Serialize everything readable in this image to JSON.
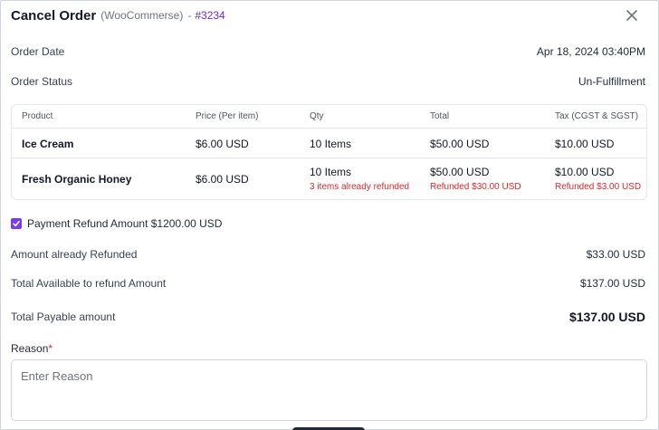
{
  "header": {
    "title": "Cancel Order",
    "source": "(WooCommerse)",
    "separator": "-",
    "order_ref": "#3234",
    "close_icon": "close-icon"
  },
  "order_date": {
    "label": "Order Date",
    "value": "Apr 18, 2024 03:40PM"
  },
  "order_status": {
    "label": "Order Status",
    "value": "Un-Fulfillment",
    "color": "#dc2626"
  },
  "table": {
    "columns": [
      "Product",
      "Price (Per item)",
      "Qty",
      "Total",
      "Tax (CGST & SGST)"
    ],
    "rows": [
      {
        "product": "Ice Cream",
        "price": "$6.00 USD",
        "qty": "10 Items",
        "qty_note": "",
        "total": "$50.00 USD",
        "total_note": "",
        "tax": "$10.00 USD",
        "tax_note": ""
      },
      {
        "product": "Fresh Organic Honey",
        "price": "$6.00 USD",
        "qty": "10 Items",
        "qty_note": "3 items already refunded",
        "total": "$50.00 USD",
        "total_note": "Refunded $30.00 USD",
        "tax": "$10.00 USD",
        "tax_note": "Refunded $3.00 USD"
      }
    ]
  },
  "payment_refund": {
    "label": "Payment Refund Amount $1200.00 USD",
    "checked": true,
    "accent": "#7c3aed"
  },
  "amount_refunded": {
    "label": "Amount already Refunded",
    "value": "$33.00 USD"
  },
  "available_refund": {
    "label": "Total Available to refund Amount",
    "value": "$137.00 USD"
  },
  "total_payable": {
    "label": "Total Payable amount",
    "value": "$137.00 USD"
  },
  "reason": {
    "label": "Reason",
    "required_mark": "*",
    "placeholder": "Enter Reason"
  }
}
